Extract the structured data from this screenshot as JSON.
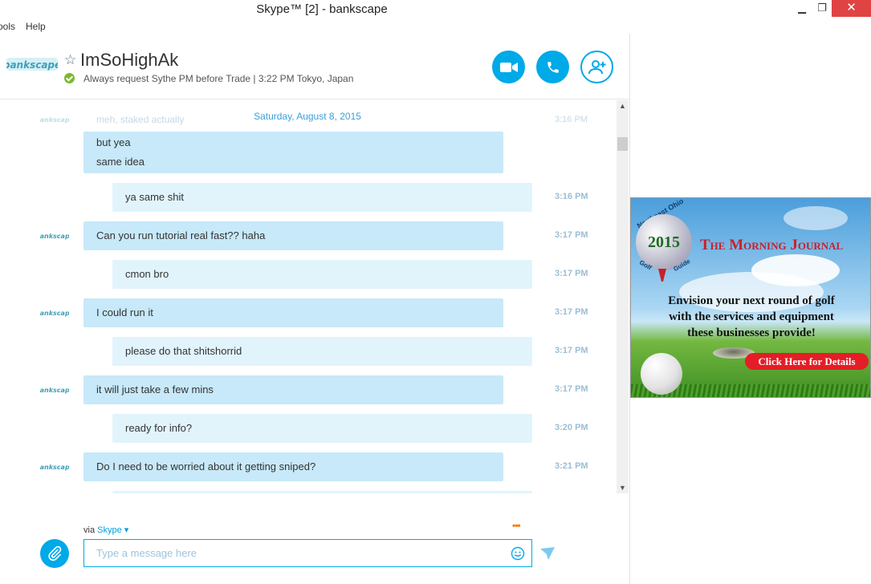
{
  "window": {
    "title": "Skype™ [2] - bankscape",
    "minimize_glyph": "▁",
    "maximize_glyph": "❐",
    "close_glyph": "✕"
  },
  "menu": {
    "tools": "Tools",
    "help": "Help"
  },
  "contact": {
    "name": "ImSoHighAk",
    "status_text": "Always request Sythe PM before Trade  |  3:22 PM Tokyo, Japan",
    "status_color": "#7cb82f"
  },
  "header_buttons": {
    "video_icon": "video-camera-icon",
    "call_icon": "phone-icon",
    "add_icon": "add-contact-icon",
    "accent": "#00a9e8"
  },
  "conversation": {
    "date_separator": "Saturday, August 8, 2015",
    "faded_message": "meh, staked actually",
    "faded_time": "3:16 PM",
    "messages": [
      {
        "direction": "in",
        "lines": [
          "but yea",
          "same idea"
        ],
        "time": ""
      },
      {
        "direction": "out",
        "text": "ya same shit",
        "time": "3:16 PM"
      },
      {
        "direction": "in",
        "text": "Can you run tutorial real fast?? haha",
        "time": "3:17 PM"
      },
      {
        "direction": "out",
        "text": "cmon bro",
        "time": "3:17 PM"
      },
      {
        "direction": "in",
        "text": "I could run it",
        "time": "3:17 PM"
      },
      {
        "direction": "out",
        "text": "please do that shitshorrid",
        "time": "3:17 PM"
      },
      {
        "direction": "in",
        "text": "it will just take a few mins",
        "time": "3:17 PM"
      },
      {
        "direction": "out",
        "text": "ready for info?",
        "time": "3:20 PM"
      },
      {
        "direction": "in",
        "text": "Do I need to be worried about it getting sniped?",
        "time": "3:21 PM"
      }
    ]
  },
  "compose": {
    "via_label": "via",
    "via_service": "Skype",
    "typing_indicator": "•••",
    "placeholder": "Type a message here",
    "value": ""
  },
  "ad": {
    "logo_top": "Northeast Ohio",
    "logo_year": "2015",
    "logo_left": "Golf",
    "logo_right": "Guide",
    "publication": "The Morning Journal",
    "copy_line1": "Envision your next round of golf",
    "copy_line2": "with the services and equipment",
    "copy_line3": "these businesses provide!",
    "cta": "Click Here for Details"
  }
}
